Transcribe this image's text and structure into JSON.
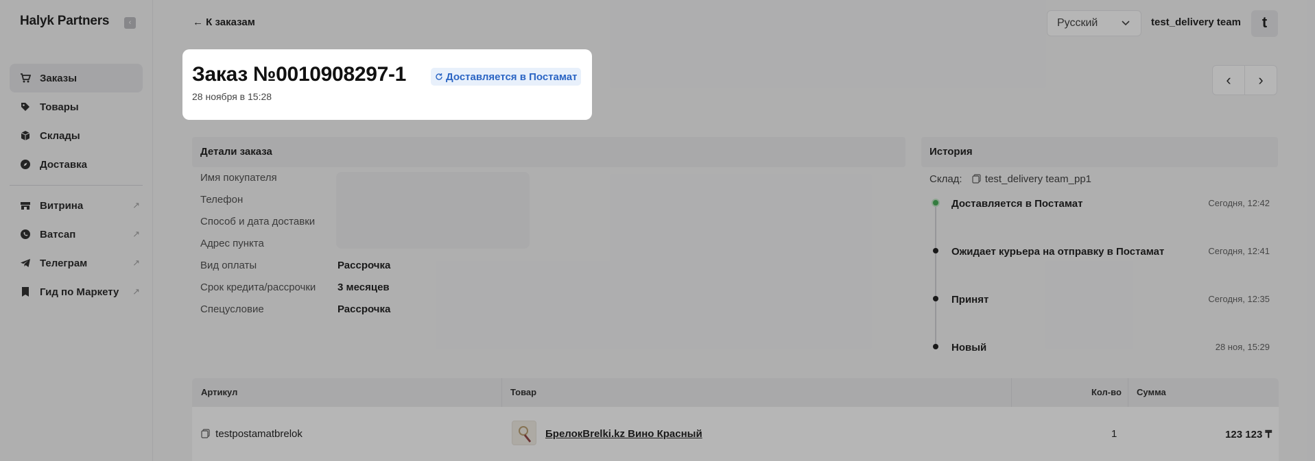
{
  "app": {
    "brand": "Halyk Partners"
  },
  "sidebar": {
    "items": [
      {
        "label": "Заказы",
        "icon": "cart-icon",
        "active": true
      },
      {
        "label": "Товары",
        "icon": "tag-icon"
      },
      {
        "label": "Склады",
        "icon": "box-icon"
      },
      {
        "label": "Доставка",
        "icon": "compass-icon"
      },
      {
        "label": "Витрина",
        "icon": "store-icon",
        "external": true
      },
      {
        "label": "Ватсап",
        "icon": "whatsapp-icon",
        "external": true
      },
      {
        "label": "Телеграм",
        "icon": "telegram-icon",
        "external": true
      },
      {
        "label": "Гид по Маркету",
        "icon": "bookmark-icon",
        "external": true
      }
    ]
  },
  "header": {
    "back_label": "← К заказам",
    "language": "Русский",
    "team_name": "test_delivery team",
    "avatar_letter": "t"
  },
  "order": {
    "title": "Заказ №0010908297-1",
    "status": "Доставляется в Постамат",
    "date": "28 ноября в 15:28"
  },
  "details": {
    "heading": "Детали заказа",
    "rows": [
      {
        "label": "Имя покупателя",
        "value": ""
      },
      {
        "label": "Телефон",
        "value": ""
      },
      {
        "label": "Способ и дата доставки",
        "value": ""
      },
      {
        "label": "Адрес пункта",
        "value": ""
      },
      {
        "label": "Вид оплаты",
        "value": "Рассрочка"
      },
      {
        "label": "Срок кредита/рассрочки",
        "value": "3 месяцев"
      },
      {
        "label": "Спецусловие",
        "value": "Рассрочка"
      }
    ]
  },
  "history": {
    "heading": "История",
    "warehouse_label": "Склад:",
    "warehouse_value": "test_delivery team_pp1",
    "events": [
      {
        "label": "Доставляется в Постамат",
        "time": "Сегодня, 12:42"
      },
      {
        "label": "Ожидает курьера на отправку в Постамат",
        "time": "Сегодня, 12:41"
      },
      {
        "label": "Принят",
        "time": "Сегодня, 12:35"
      },
      {
        "label": "Новый",
        "time": "28 ноя, 15:29"
      }
    ]
  },
  "items_table": {
    "headers": {
      "sku": "Артикул",
      "product": "Товар",
      "qty": "Кол-во",
      "sum": "Сумма"
    },
    "rows": [
      {
        "sku": "testpostamatbrelok",
        "product": "БрелокBrelki.kz Вино Красный",
        "qty": "1",
        "sum": "123 123 ₸"
      }
    ]
  },
  "colors": {
    "status_text": "#2b65c4",
    "status_bg": "#e8f0fb",
    "timeline_active": "#3aa84b"
  }
}
